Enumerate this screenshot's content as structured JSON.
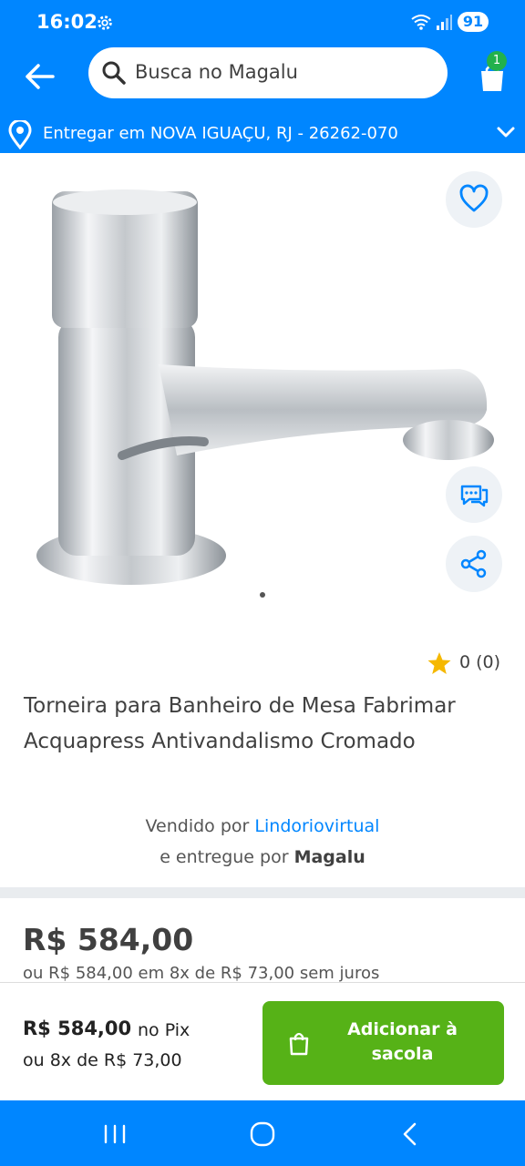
{
  "status_bar": {
    "time": "16:02",
    "battery": "91",
    "icons": [
      "gear-icon",
      "wifi-icon",
      "signal-icon"
    ]
  },
  "header": {
    "search_placeholder": "Busca no Magalu",
    "cart_count": "1",
    "icons": [
      "back-arrow-icon",
      "search-icon",
      "shopping-bag-icon"
    ]
  },
  "location": {
    "text": "Entregar em NOVA IGUAÇU, RJ - 26262-070",
    "icons": [
      "location-pin-icon",
      "chevron-down-icon"
    ]
  },
  "product": {
    "title": "Torneira para Banheiro de Mesa Fabrimar Acquapress Antivandalismo Cromado",
    "rating_value": "0 (0)",
    "image_icons": [
      "heart-icon",
      "chat-icon",
      "share-icon"
    ],
    "seller_prefix": "Vendido por",
    "seller_name": "Lindoriovirtual",
    "delivery_prefix": "e entregue por",
    "delivery_name": "Magalu",
    "price": "R$ 584,00",
    "installments": "ou R$ 584,00 em 8x de R$ 73,00 sem juros"
  },
  "buy_bar": {
    "pix_price": "R$ 584,00",
    "pix_label": "no Pix",
    "installments": "ou 8x de R$ 73,00",
    "add_button_line1": "Adicionar à",
    "add_button_line2": "sacola"
  },
  "nav_bar": {
    "icons": [
      "recent-apps-icon",
      "home-icon",
      "back-icon"
    ]
  },
  "colors": {
    "brand_blue": "#0086ff",
    "buy_green": "#56b217",
    "badge_green": "#22b14c",
    "star_yellow": "#f5b800"
  }
}
